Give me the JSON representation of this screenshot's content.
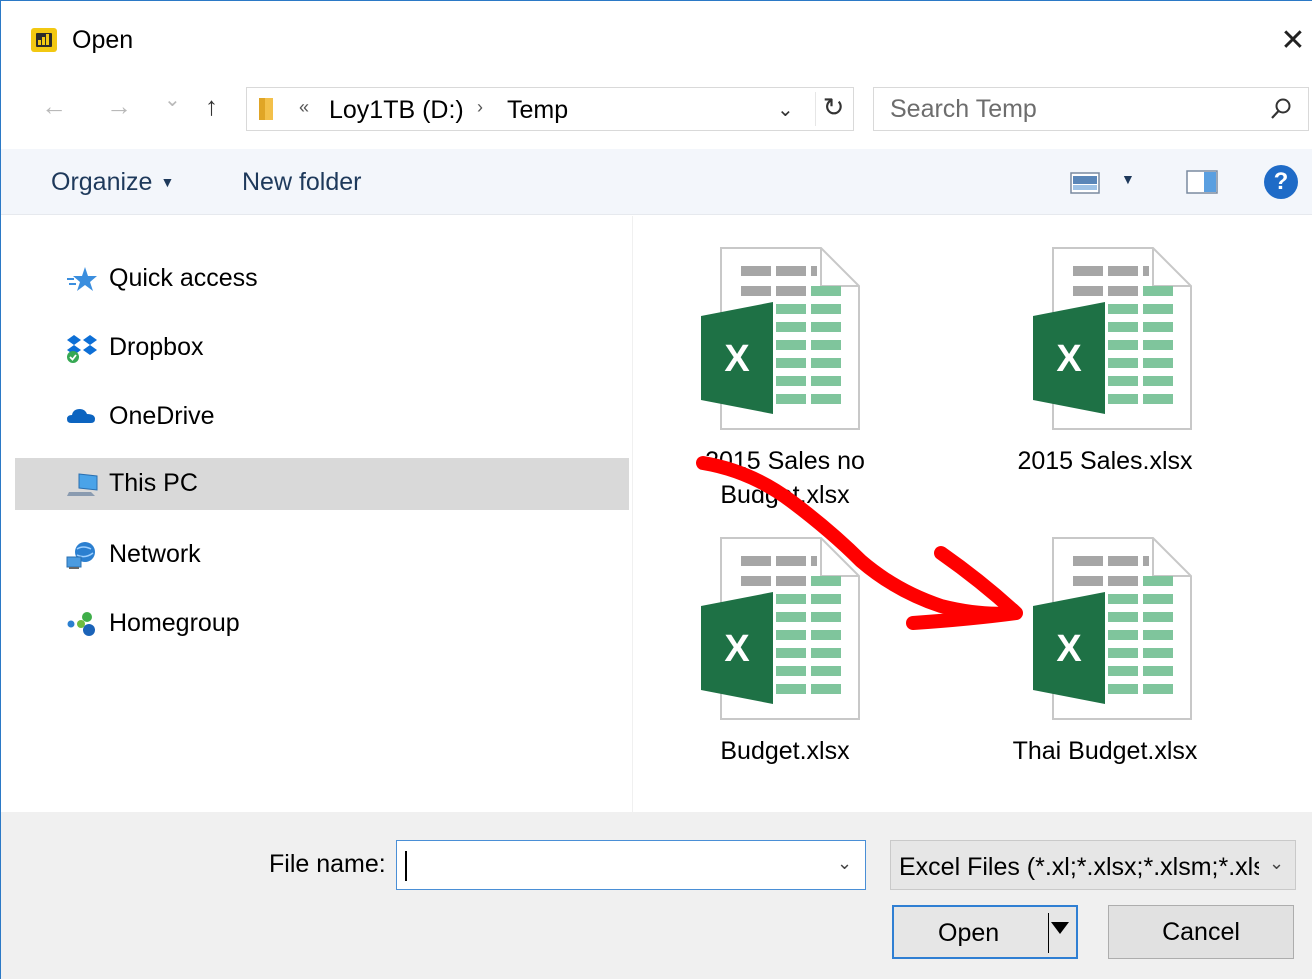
{
  "window": {
    "title": "Open",
    "close_symbol": "✕"
  },
  "nav": {
    "back_symbol": "←",
    "forward_symbol": "→",
    "recent_symbol": "⌄",
    "up_symbol": "↑"
  },
  "address": {
    "overflow_symbol": "«",
    "crumbs": [
      "Loy1TB (D:)",
      "Temp"
    ],
    "separator": "›",
    "dropdown_symbol": "⌄",
    "refresh_symbol": "↻"
  },
  "search": {
    "placeholder": "Search Temp"
  },
  "toolbar": {
    "organize_label": "Organize",
    "new_folder_label": "New folder",
    "help_symbol": "?"
  },
  "sidebar": {
    "items": [
      {
        "label": "Quick access",
        "icon": "star-icon"
      },
      {
        "label": "Dropbox",
        "icon": "dropbox-icon"
      },
      {
        "label": "OneDrive",
        "icon": "onedrive-icon"
      },
      {
        "label": "This PC",
        "icon": "pc-icon",
        "selected": true
      },
      {
        "label": "Network",
        "icon": "network-icon"
      },
      {
        "label": "Homegroup",
        "icon": "homegroup-icon"
      }
    ]
  },
  "files": [
    {
      "name_line1": "2015 Sales no",
      "name_line2": "Budget.xlsx",
      "icon": "excel-file-icon"
    },
    {
      "name_line1": "2015 Sales.xlsx",
      "name_line2": "",
      "icon": "excel-file-icon"
    },
    {
      "name_line1": "Budget.xlsx",
      "name_line2": "",
      "icon": "excel-file-icon"
    },
    {
      "name_line1": "Thai Budget.xlsx",
      "name_line2": "",
      "icon": "excel-file-icon"
    }
  ],
  "footer": {
    "file_name_label": "File name:",
    "file_name_value": "",
    "file_type_value": "Excel Files (*.xl;*.xlsx;*.xlsm;*.xlsb",
    "dropdown_symbol": "⌄",
    "open_label": "Open",
    "cancel_label": "Cancel"
  },
  "colors": {
    "excel_green": "#1e7145",
    "annotation_red": "#ff0000",
    "selection_bg": "#d9d9d9",
    "accent_blue": "#2f7fd3"
  }
}
